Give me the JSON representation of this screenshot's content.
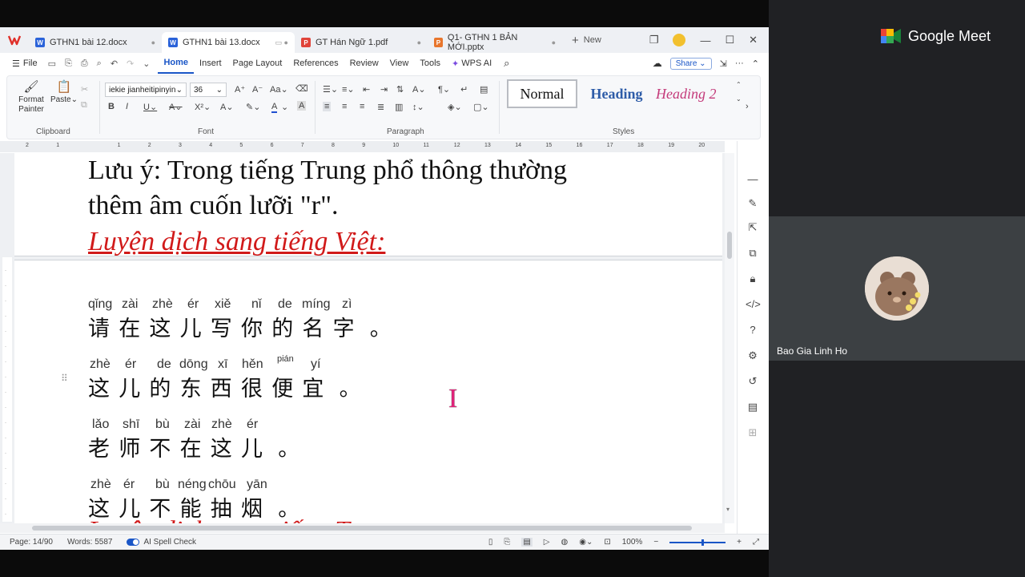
{
  "tabs": [
    {
      "label": "GTHN1 bài 12.docx",
      "icon": "W",
      "color": "#2b63d9",
      "active": false
    },
    {
      "label": "GTHN1 bài 13.docx",
      "icon": "W",
      "color": "#2b63d9",
      "active": true
    },
    {
      "label": "GT Hán Ngữ 1.pdf",
      "icon": "P",
      "color": "#e0443a",
      "active": false
    },
    {
      "label": "Q1- GTHN 1 BẢN MỚI.pptx",
      "icon": "P",
      "color": "#e8762d",
      "active": false
    }
  ],
  "new_tab_label": "New",
  "menu": {
    "file": "File",
    "items": [
      "Home",
      "Insert",
      "Page Layout",
      "References",
      "Review",
      "View",
      "Tools"
    ],
    "active": "Home",
    "wps_ai": "WPS AI",
    "share": "Share"
  },
  "ribbon": {
    "clipboard": {
      "format_painter": "Format Painter",
      "paste": "Paste",
      "label": "Clipboard"
    },
    "font": {
      "name": "iekie jianheitipinyin",
      "size": "36",
      "label": "Font"
    },
    "paragraph": {
      "label": "Paragraph"
    },
    "styles": {
      "normal": "Normal",
      "heading": "Heading",
      "heading2": "Heading 2",
      "label": "Styles"
    }
  },
  "ruler": {
    "ticks": [
      "2",
      "1",
      "",
      "1",
      "2",
      "3",
      "4",
      "5",
      "6",
      "7",
      "8",
      "9",
      "10",
      "11",
      "12",
      "13",
      "14",
      "15",
      "16",
      "17",
      "18",
      "19",
      "20"
    ]
  },
  "document": {
    "note_line1": "Lưu ý: Trong tiếng Trung phổ thông thường",
    "note_line2": "thêm âm cuốn lưỡi \"r\".",
    "heading_viet": "Luyện dịch sang tiếng Việt:",
    "heading_trung": "Luyện dịch sang tiếng Trung:",
    "sentences": [
      {
        "pinyin": [
          "qǐng",
          "zài",
          "zhè",
          "ér",
          "xiě",
          "nǐ",
          "de",
          "míng",
          "zì"
        ],
        "hanzi": [
          "请",
          "在",
          "这",
          "儿",
          "写",
          "你",
          "的",
          "名",
          "字",
          "。"
        ]
      },
      {
        "pinyin": [
          "zhè",
          "ér",
          "de",
          "dōng",
          "xī",
          "hěn",
          "pián",
          "yí"
        ],
        "hanzi": [
          "这",
          "儿",
          "的",
          "东",
          "西",
          "很",
          "便",
          "宜",
          "。"
        ]
      },
      {
        "pinyin": [
          "lǎo",
          "shī",
          "bù",
          "zài",
          "zhè",
          "ér"
        ],
        "hanzi": [
          "老",
          "师",
          "不",
          "在",
          "这",
          "儿",
          "。"
        ]
      },
      {
        "pinyin": [
          "zhè",
          "ér",
          "bù",
          "néng",
          "chōu",
          "yān"
        ],
        "hanzi": [
          "这",
          "儿",
          "不",
          "能",
          "抽",
          "烟",
          "。"
        ]
      }
    ]
  },
  "status": {
    "page": "Page: 14/90",
    "words": "Words: 5587",
    "spell": "AI Spell Check",
    "zoom": "100%"
  },
  "meet": {
    "brand": "Google Meet",
    "participant": "Bao Gia Linh Ho"
  }
}
